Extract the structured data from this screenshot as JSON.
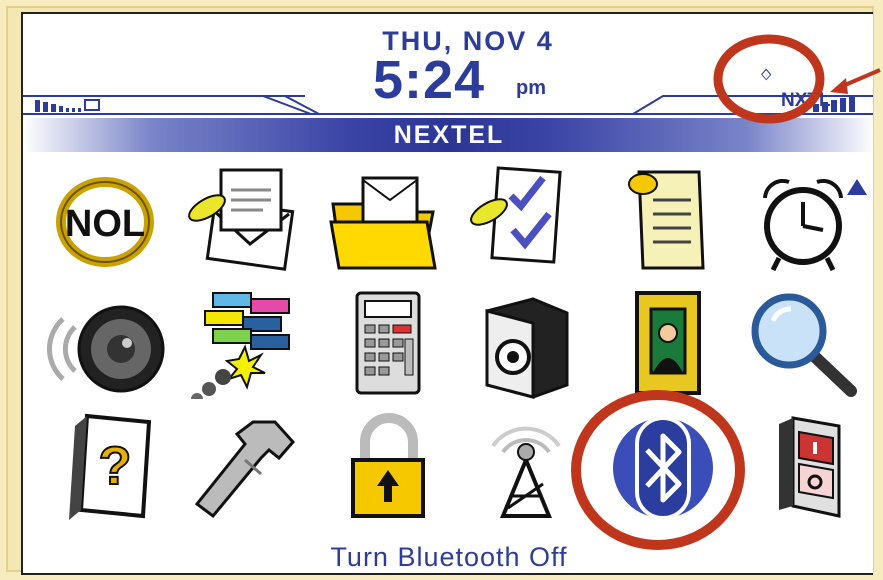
{
  "status": {
    "date": "THU, NOV 4",
    "time": "5:24",
    "ampm": "pm",
    "carrier": "NEXTEL",
    "network_label": "NXTL",
    "bluetooth_indicator": "bluetooth-status-icon"
  },
  "apps": [
    {
      "name": "nol-icon",
      "label": "NOL"
    },
    {
      "name": "messages-icon"
    },
    {
      "name": "saved-messages-icon"
    },
    {
      "name": "tasks-icon"
    },
    {
      "name": "memopad-icon"
    },
    {
      "name": "alarm-clock-icon"
    },
    {
      "name": "speaker-icon"
    },
    {
      "name": "brickbreaker-icon"
    },
    {
      "name": "calculator-icon"
    },
    {
      "name": "vault-icon"
    },
    {
      "name": "picture-frame-icon"
    },
    {
      "name": "search-magnifier-icon"
    },
    {
      "name": "help-icon",
      "label": "?"
    },
    {
      "name": "wrench-options-icon"
    },
    {
      "name": "lock-icon"
    },
    {
      "name": "antenna-icon"
    },
    {
      "name": "bluetooth-icon"
    },
    {
      "name": "power-switch-icon"
    }
  ],
  "selected_hint": "Turn Bluetooth Off",
  "colors": {
    "accent": "#2c3c9a",
    "annotation": "#c0361c",
    "frame": "#f4e7b3"
  }
}
